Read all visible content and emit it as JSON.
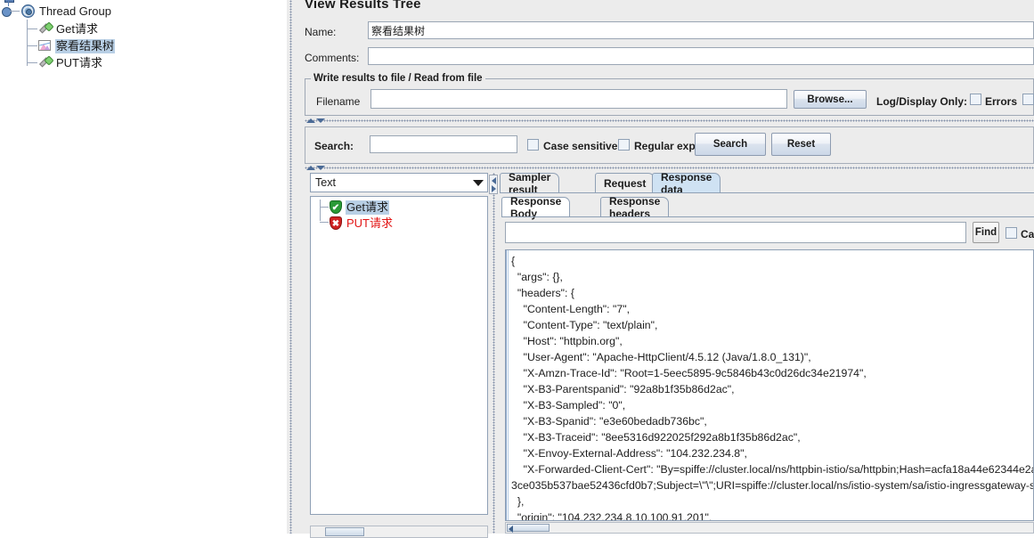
{
  "tree": {
    "items": [
      {
        "label": "Thread Group",
        "icon": "gear-icon",
        "depth": 0,
        "selected": false
      },
      {
        "label": "Get请求",
        "icon": "sampler-pipette-icon",
        "depth": 1,
        "selected": false
      },
      {
        "label": "察看结果树",
        "icon": "listener-chart-icon",
        "depth": 1,
        "selected": true
      },
      {
        "label": "PUT请求",
        "icon": "sampler-pipette-icon",
        "depth": 1,
        "selected": false
      }
    ]
  },
  "panel": {
    "title": "View Results Tree",
    "name_label": "Name:",
    "name_value": "察看结果树",
    "comments_label": "Comments:",
    "comments_value": "",
    "file_group_title": "Write results to file / Read from file",
    "filename_label": "Filename",
    "filename_value": "",
    "browse_label": "Browse...",
    "log_display_label": "Log/Display Only:",
    "errors_label": "Errors",
    "errors_checked": false,
    "successes_checked": false
  },
  "search": {
    "label": "Search:",
    "value": "",
    "case_sensitive_label": "Case sensitive",
    "case_sensitive_checked": false,
    "regex_label": "Regular exp.",
    "regex_checked": false,
    "search_button": "Search",
    "reset_button": "Reset"
  },
  "results": {
    "renderer_selected": "Text",
    "rows": [
      {
        "label": "Get请求",
        "status": "success",
        "selected": true
      },
      {
        "label": "PUT请求",
        "status": "error",
        "selected": false
      }
    ]
  },
  "tabs": {
    "main": [
      {
        "label": "Sampler result",
        "active": false
      },
      {
        "label": "Request",
        "active": false
      },
      {
        "label": "Response data",
        "active": true
      }
    ],
    "sub": [
      {
        "label": "Response Body",
        "active": true
      },
      {
        "label": "Response headers",
        "active": false
      }
    ]
  },
  "find": {
    "value": "",
    "find_button": "Find",
    "case_label": "Ca",
    "case_checked": false
  },
  "response_body": {
    "lines": [
      "{",
      "  \"args\": {},",
      "  \"headers\": {",
      "    \"Content-Length\": \"7\",",
      "    \"Content-Type\": \"text/plain\",",
      "    \"Host\": \"httpbin.org\",",
      "    \"User-Agent\": \"Apache-HttpClient/4.5.12 (Java/1.8.0_131)\",",
      "    \"X-Amzn-Trace-Id\": \"Root=1-5eec5895-9c5846b43c0d26dc34e21974\",",
      "    \"X-B3-Parentspanid\": \"92a8b1f35b86d2ac\",",
      "    \"X-B3-Sampled\": \"0\",",
      "    \"X-B3-Spanid\": \"e3e60bedadb736bc\",",
      "    \"X-B3-Traceid\": \"8ee5316d922025f292a8b1f35b86d2ac\",",
      "    \"X-Envoy-External-Address\": \"104.232.234.8\",",
      "    \"X-Forwarded-Client-Cert\": \"By=spiffe://cluster.local/ns/httpbin-istio/sa/httpbin;Hash=acfa18a44e62344e2a",
      "3ce035b537bae52436cfd0b7;Subject=\\\"\\\";URI=spiffe://cluster.local/ns/istio-system/sa/istio-ingressgateway-s",
      "  },",
      "  \"origin\": \"104.232.234.8,10.100.91.201\","
    ]
  }
}
